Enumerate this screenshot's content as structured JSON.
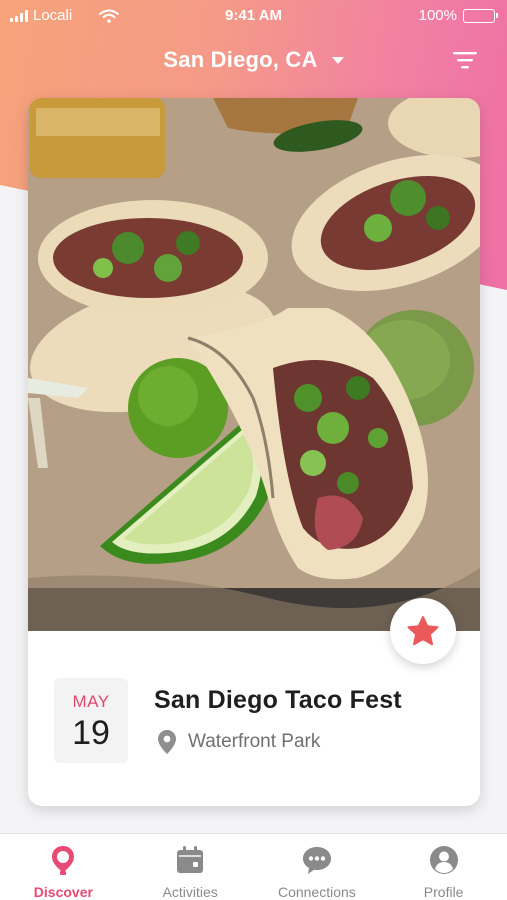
{
  "status_bar": {
    "carrier": "Locali",
    "time": "9:41 AM",
    "battery": "100%"
  },
  "header": {
    "location": "San Diego, CA",
    "filter_icon": "filter-lines-icon"
  },
  "event": {
    "image_subject": "tacos with lime",
    "favorite_icon": "star-icon",
    "month": "MAY",
    "day": "19",
    "title": "San Diego Taco Fest",
    "venue_icon": "location-pin-icon",
    "venue": "Waterfront Park"
  },
  "tabs": [
    {
      "label": "Discover",
      "icon": "discover-pin-icon",
      "active": true
    },
    {
      "label": "Activities",
      "icon": "calendar-icon",
      "active": false
    },
    {
      "label": "Connections",
      "icon": "chat-bubble-icon",
      "active": false
    },
    {
      "label": "Profile",
      "icon": "person-icon",
      "active": false
    }
  ],
  "colors": {
    "accent": "#e84a73",
    "header_gradient_start": "#f6a37a",
    "header_gradient_end": "#ee6fa5",
    "star": "#ea5a5a",
    "inactive_icon": "#8a8a8a"
  }
}
